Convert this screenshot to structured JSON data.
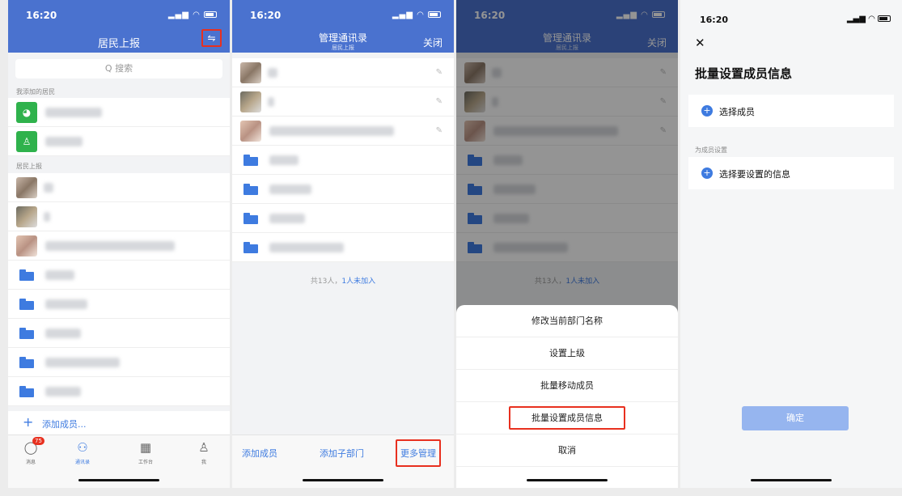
{
  "colors": {
    "header": "#4a72cf",
    "accent": "#3e7be0",
    "highlight": "#e8301f"
  },
  "phone1": {
    "time": "16:20",
    "title": "居民上报",
    "filter_icon": "sliders-icon",
    "search_placeholder": "Q 搜索",
    "section_added": "我添加的居民",
    "section_reports": "居民上报",
    "add_member": "添加成员...",
    "tabs": [
      {
        "label": "消息",
        "icon": "chat-icon",
        "badge": "75"
      },
      {
        "label": "通讯录",
        "icon": "org-chart-icon"
      },
      {
        "label": "工作台",
        "icon": "grid-icon"
      },
      {
        "label": "我",
        "icon": "person-icon"
      }
    ]
  },
  "phone2": {
    "time": "16:20",
    "title": "管理通讯录",
    "subtitle": "居民上报",
    "close": "关闭",
    "footer_count": "共13人，",
    "footer_link": "1人未加入",
    "actions": [
      "添加成员",
      "添加子部门",
      "更多管理"
    ]
  },
  "phone3": {
    "time": "16:20",
    "title": "管理通讯录",
    "subtitle": "居民上报",
    "close": "关闭",
    "footer_count": "共13人，",
    "footer_link": "1人未加入",
    "options": [
      "修改当前部门名称",
      "设置上级",
      "批量移动成员",
      "批量设置成员信息",
      "取消"
    ]
  },
  "phone4": {
    "time": "16:20",
    "title": "批量设置成员信息",
    "select_member": "选择成员",
    "section": "为成员设置",
    "select_info": "选择要设置的信息",
    "confirm": "确定"
  }
}
